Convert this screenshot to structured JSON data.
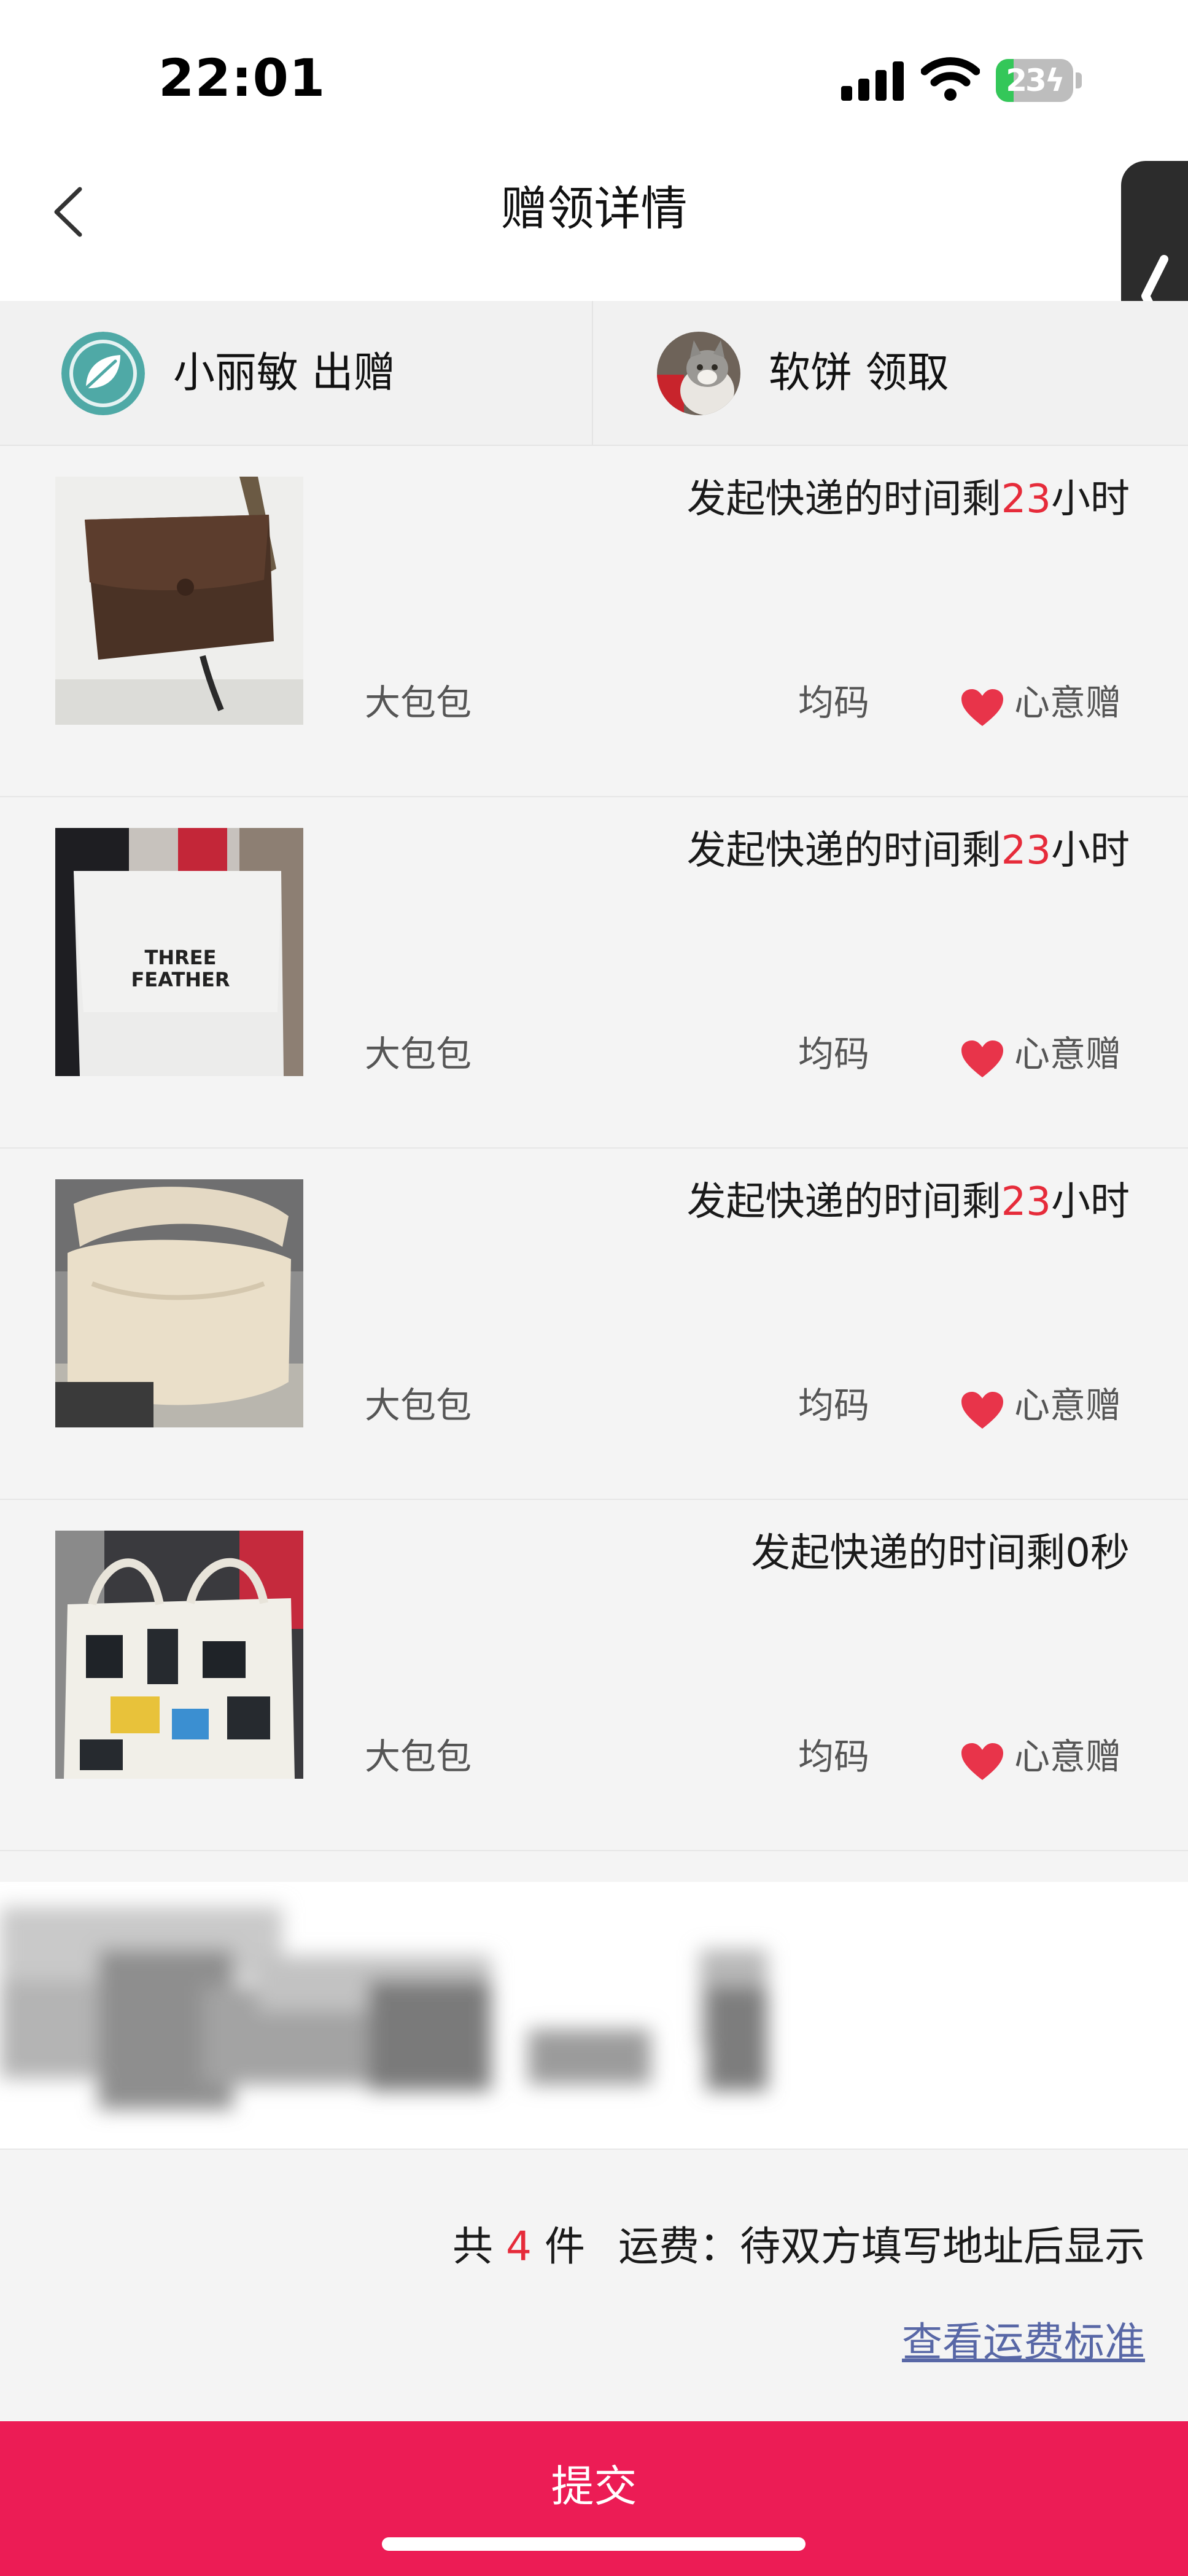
{
  "status_bar": {
    "time": "22:01",
    "battery_level": "23",
    "battery_fill_fraction": 0.23,
    "icons": [
      "signal-icon",
      "wifi-icon",
      "charging-battery-icon"
    ]
  },
  "header": {
    "title": "赠领详情",
    "back_icon": "chevron-left-icon",
    "side_handle_icon": "chevron-left-icon"
  },
  "parties": {
    "giver": {
      "label": "小丽敏 出赠",
      "avatar": "leaf-logo-avatar"
    },
    "receiver": {
      "label": "软饼 领取",
      "avatar": "cat-photo-avatar"
    }
  },
  "items": [
    {
      "photo": "brown-leather-bag-photo",
      "countdown_prefix": "发起快递的时间剩",
      "countdown_value": "23",
      "countdown_suffix": "小时",
      "name": "大包包",
      "size": "均码",
      "tag": "心意赠"
    },
    {
      "photo": "three-feather-canvas-bag-photo",
      "countdown_prefix": "发起快递的时间剩",
      "countdown_value": "23",
      "countdown_suffix": "小时",
      "name": "大包包",
      "size": "均码",
      "tag": "心意赠",
      "photo_text_line1": "THREE",
      "photo_text_line2": "FEATHER"
    },
    {
      "photo": "cream-fleece-bag-photo",
      "countdown_prefix": "发起快递的时间剩",
      "countdown_value": "23",
      "countdown_suffix": "小时",
      "name": "大包包",
      "size": "均码",
      "tag": "心意赠"
    },
    {
      "photo": "printed-tote-bag-photo",
      "countdown_prefix": "发起快递的时间剩0秒",
      "countdown_value": "",
      "countdown_suffix": "",
      "name": "大包包",
      "size": "均码",
      "tag": "心意赠"
    }
  ],
  "summary": {
    "count_prefix": "共",
    "count": "4",
    "count_suffix": "件",
    "shipping_label": "运费：",
    "shipping_value": "待双方填写地址后显示",
    "fee_link": "查看运费标准"
  },
  "submit": {
    "label": "提交"
  },
  "colors": {
    "accent": "#ec1c55",
    "highlight_red": "#e62b3a",
    "link_blue": "#5867a6",
    "heart_red": "#e8344a"
  }
}
